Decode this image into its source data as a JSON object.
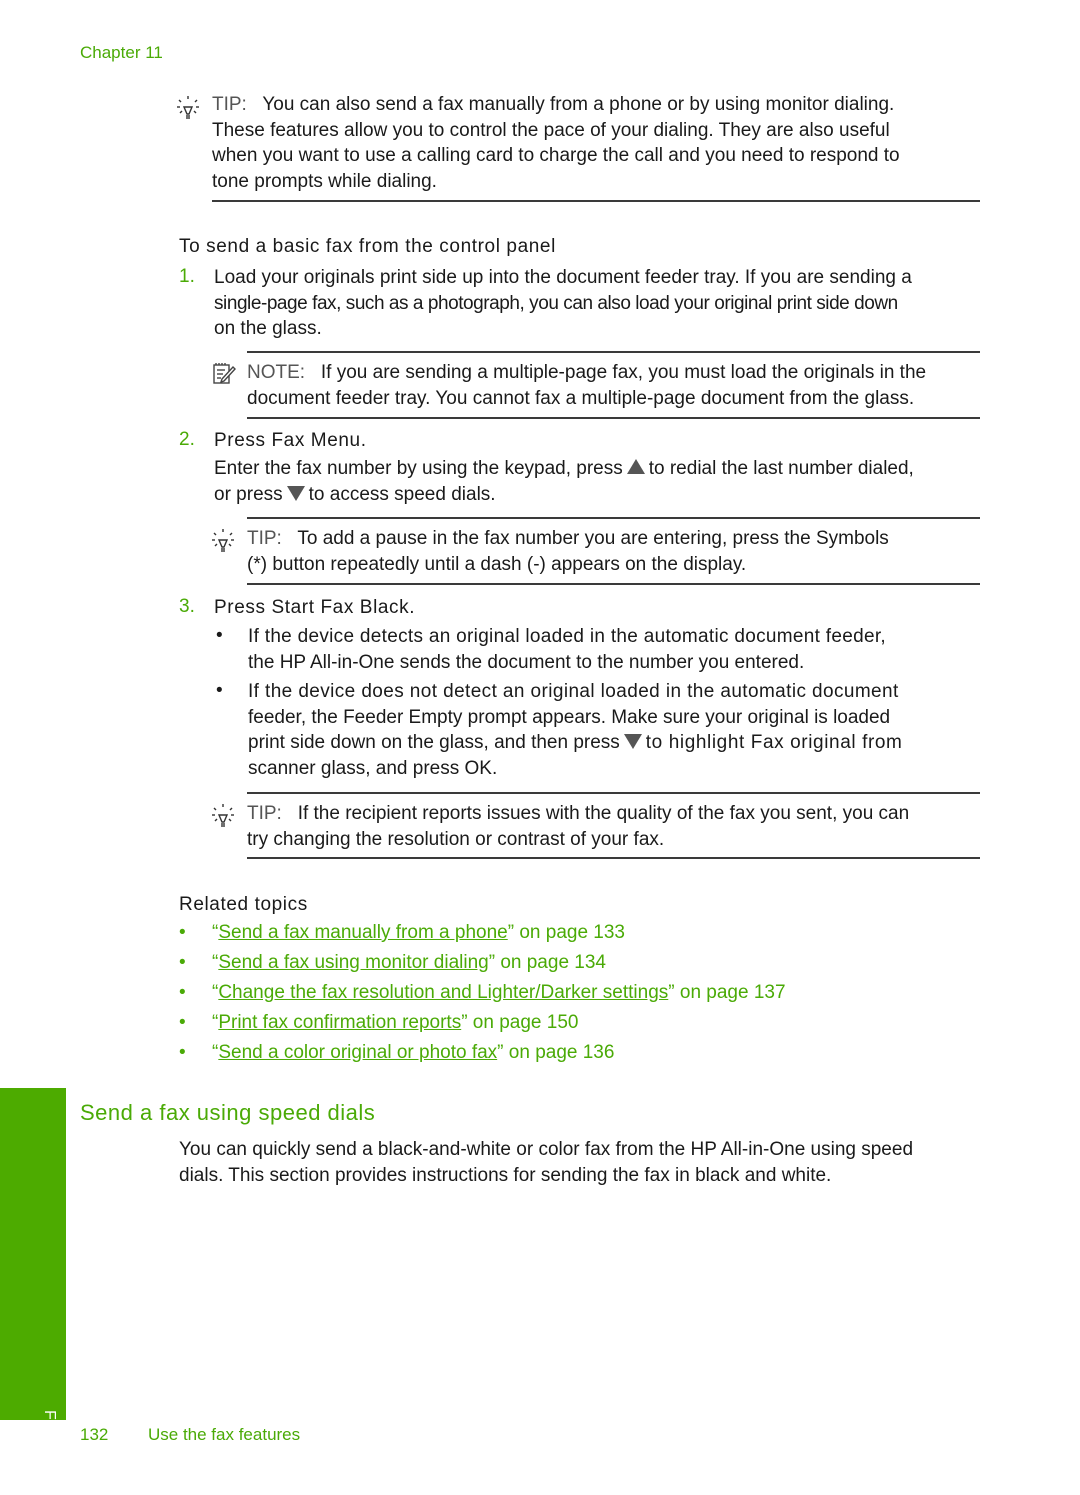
{
  "header": {
    "chapter": "Chapter 11"
  },
  "tip1": {
    "label": "TIP:",
    "lines": [
      "You can also send a fax manually from a phone or by using monitor dialing.",
      "These features allow you to control the pace of your dialing. They are also useful",
      "when you want to use a calling card to charge the call and you need to respond to",
      "tone prompts while dialing."
    ]
  },
  "procedure": {
    "title": "To send a basic fax from the control panel",
    "steps": [
      {
        "number": "1.",
        "lines": [
          "Load your originals print side up into the document feeder tray. If you are sending a",
          "single-page fax, such as a photograph, you can also load your original print side down",
          "on the glass."
        ],
        "note": {
          "label": "NOTE:",
          "lines": [
            "If you are sending a multiple-page fax, you must load the originals in the",
            "document feeder tray. You cannot fax a multiple-page document from the glass."
          ]
        }
      },
      {
        "number": "2.",
        "title": "Press Fax Menu.",
        "line1_a": "Enter the fax number by using the keypad, press",
        "line1_b": "to redial the last number dialed,",
        "line2_a": "or press",
        "line2_b": "to access speed dials.",
        "tip": {
          "label": "TIP:",
          "lines": [
            "To add a pause in the fax number you are entering, press the Symbols",
            "(*) button repeatedly until a dash (-) appears on the display."
          ]
        }
      },
      {
        "number": "3.",
        "title": "Press Start Fax Black.",
        "bullets": [
          {
            "lines": [
              "If the device detects an original loaded in the automatic document feeder,",
              "the HP All-in-One sends the document to the number you entered."
            ]
          },
          {
            "lines": [
              "If the device does not detect an original loaded in the automatic document",
              "feeder, the Feeder Empty prompt appears. Make sure your original is loaded"
            ],
            "line3_a": "print side down on the glass, and then press",
            "line3_b": "to highlight Fax original from",
            "line4": "scanner glass, and press OK."
          }
        ],
        "tip": {
          "label": "TIP:",
          "lines": [
            "If the recipient reports issues with the quality of the fax you sent, you can",
            "try changing the resolution or contrast of your fax."
          ]
        }
      }
    ]
  },
  "related": {
    "title": "Related topics",
    "items": [
      {
        "link": "Send a fax manually from a phone",
        "suffix": " on page 133"
      },
      {
        "link": "Send a fax using monitor dialing",
        "suffix": " on page 134"
      },
      {
        "link": "Change the fax resolution and Lighter/Darker settings",
        "suffix": " on page 137"
      },
      {
        "link": "Print fax confirmation reports",
        "suffix": " on page 150"
      },
      {
        "link": "Send a color original or photo fax",
        "suffix": " on page 136"
      }
    ]
  },
  "section": {
    "heading": "Send a fax using speed dials",
    "lines": [
      "You can quickly send a black-and-white or color fax from the HP All-in-One using speed",
      "dials. This section provides instructions for sending the fax in black and white."
    ]
  },
  "sidebar": {
    "tab_label": "Fax"
  },
  "footer": {
    "page_number": "132",
    "title": "Use the fax features"
  },
  "colors": {
    "accent": "#4aaa06",
    "tab": "#4dab00",
    "text": "#1a1a1a"
  },
  "icons": {
    "tip": "lightbulb-icon",
    "note": "note-pencil-icon",
    "up": "up-arrow-icon",
    "down": "down-arrow-icon"
  }
}
